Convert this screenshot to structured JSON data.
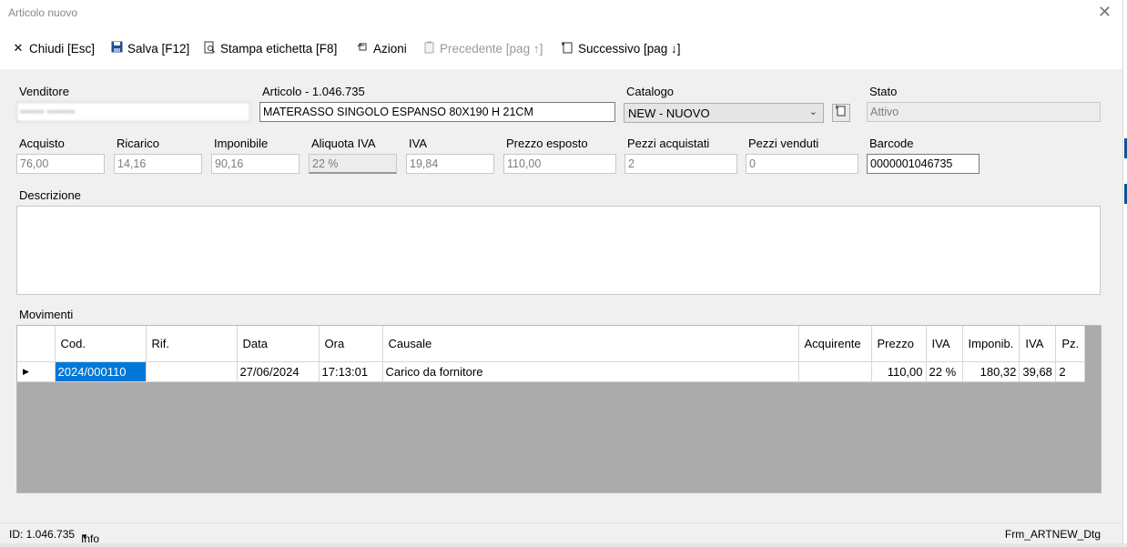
{
  "window": {
    "title": "Articolo nuovo",
    "close_glyph": "✕"
  },
  "toolbar": {
    "close": {
      "label": "Chiudi [Esc]",
      "icon": "close-icon"
    },
    "save": {
      "label": "Salva [F12]",
      "icon": "save-icon"
    },
    "print": {
      "label": "Stampa etichetta [F8]",
      "icon": "print-preview-icon"
    },
    "actions": {
      "label": "Azioni",
      "icon": "actions-icon"
    },
    "previous": {
      "label": "Precedente [pag ↑]",
      "icon": "previous-icon"
    },
    "next": {
      "label": "Successivo [pag ↓]",
      "icon": "next-icon"
    }
  },
  "form": {
    "venditore": {
      "label": "Venditore",
      "value": "•••••• •••••••"
    },
    "articolo": {
      "label": "Articolo - 1.046.735",
      "value": "MATERASSO SINGOLO ESPANSO 80X190 H 21CM"
    },
    "catalogo": {
      "label": "Catalogo",
      "value": "NEW - NUOVO"
    },
    "stato": {
      "label": "Stato",
      "value": "Attivo"
    },
    "acquisto": {
      "label": "Acquisto",
      "value": "76,00"
    },
    "ricarico": {
      "label": "Ricarico",
      "value": "14,16"
    },
    "imponibile": {
      "label": "Imponibile",
      "value": "90,16"
    },
    "aliquota_iva": {
      "label": "Aliquota IVA",
      "value": "22 %"
    },
    "iva": {
      "label": "IVA",
      "value": "19,84"
    },
    "prezzo_esposto": {
      "label": "Prezzo esposto",
      "value": "110,00"
    },
    "pezzi_acquistati": {
      "label": "Pezzi acquistati",
      "value": "2"
    },
    "pezzi_venduti": {
      "label": "Pezzi venduti",
      "value": "0"
    },
    "barcode": {
      "label": "Barcode",
      "value": "0000001046735"
    },
    "descrizione": {
      "label": "Descrizione",
      "value": ""
    }
  },
  "movimenti": {
    "label": "Movimenti",
    "columns": [
      "Cod.",
      "Rif.",
      "Data",
      "Ora",
      "Causale",
      "Acquirente",
      "Prezzo",
      "IVA",
      "Imponib.",
      "IVA",
      "Pz."
    ],
    "rows": [
      {
        "cod": "2024/000110",
        "rif": "",
        "data": "27/06/2024",
        "ora": "17:13:01",
        "causale": "Carico da fornitore",
        "acquirente": "",
        "prezzo": "110,00",
        "iva_pct": "22 %",
        "imponib": "180,32",
        "iva": "39,68",
        "pz": "2"
      }
    ]
  },
  "status": {
    "id": "ID: 1.046.735",
    "info": "Info",
    "form_name": "Frm_ARTNEW_Dtg"
  },
  "colors": {
    "selection": "#0078d7",
    "grid_background": "#ababab",
    "window_background": "#f0f0f0"
  }
}
